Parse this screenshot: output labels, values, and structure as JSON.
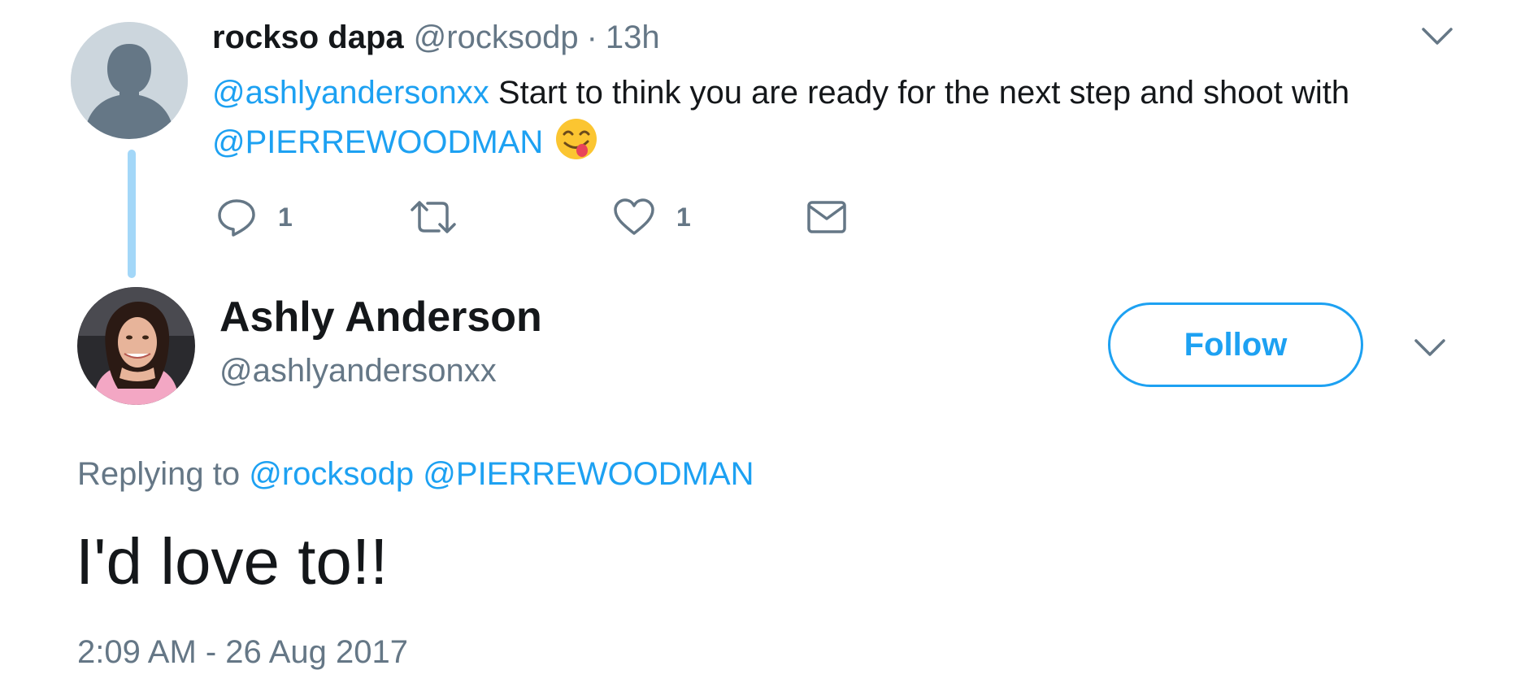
{
  "parent_tweet": {
    "author_name": "rockso dapa",
    "author_handle": "@rocksodp",
    "separator": "·",
    "time_ago": "13h",
    "text": {
      "mention_1": "@ashlyandersonxx",
      "body": " Start to think you are ready for the next step and shoot with ",
      "mention_2": "@PIERREWOODMAN"
    },
    "emoji": "face-savoring-food-emoji",
    "actions": {
      "reply_count": "1",
      "like_count": "1"
    }
  },
  "reply_tweet": {
    "author_name": "Ashly Anderson",
    "author_handle": "@ashlyandersonxx",
    "follow_label": "Follow",
    "replying_to_label": "Replying to ",
    "replying_to_1": "@rocksodp",
    "replying_to_2": "@PIERREWOODMAN",
    "text": "I'd love to!!",
    "timestamp": "2:09 AM - 26 Aug 2017"
  },
  "colors": {
    "accent": "#1da1f2",
    "secondary_text": "#657786",
    "primary_text": "#14171a",
    "thread_line": "#a3d7f8",
    "default_avatar": "#ccd6dd"
  }
}
